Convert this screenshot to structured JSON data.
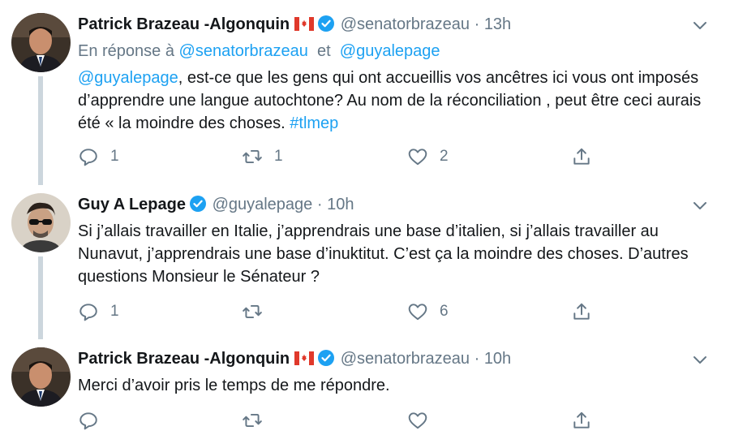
{
  "tweets": [
    {
      "name": "Patrick Brazeau -Algonquin",
      "handle": "@senatorbrazeau",
      "dot": "·",
      "time": "13h",
      "reply_prefix": "En réponse à",
      "reply_user1": "@senatorbrazeau",
      "reply_and": "et",
      "reply_user2": "@guyalepage",
      "mention": "@guyalepage",
      "text_main": ", est-ce que les gens qui ont accueillis vos ancêtres ici vous ont imposés d’apprendre une langue autochtone? Au nom de la réconciliation , peut être ceci aurais été « la moindre des choses. ",
      "hashtag": "#tlmep",
      "replies": "1",
      "retweets": "1",
      "likes": "2"
    },
    {
      "name": "Guy A Lepage",
      "handle": "@guyalepage",
      "dot": "·",
      "time": "10h",
      "text": "Si j’allais travailler en Italie, j’apprendrais une base d’italien, si j’allais travailler au Nunavut, j’apprendrais une base d’inuktitut. C’est ça la moindre des choses. D’autres questions Monsieur le Sénateur ?",
      "replies": "1",
      "retweets": "",
      "likes": "6"
    },
    {
      "name": "Patrick Brazeau -Algonquin",
      "handle": "@senatorbrazeau",
      "dot": "·",
      "time": "10h",
      "text": "Merci d’avoir pris le temps de me répondre.",
      "replies": "",
      "retweets": "",
      "likes": ""
    }
  ],
  "icons": {
    "verified": "verified-badge-icon",
    "flag": "canada-flag-icon",
    "caret": "chevron-down-icon",
    "reply": "reply-icon",
    "retweet": "retweet-icon",
    "like": "heart-icon",
    "share": "share-icon"
  },
  "colors": {
    "link": "#1da1f2",
    "secondary_text": "#657786",
    "connector": "#ccd6dd",
    "flag_red": "#e0392b"
  }
}
